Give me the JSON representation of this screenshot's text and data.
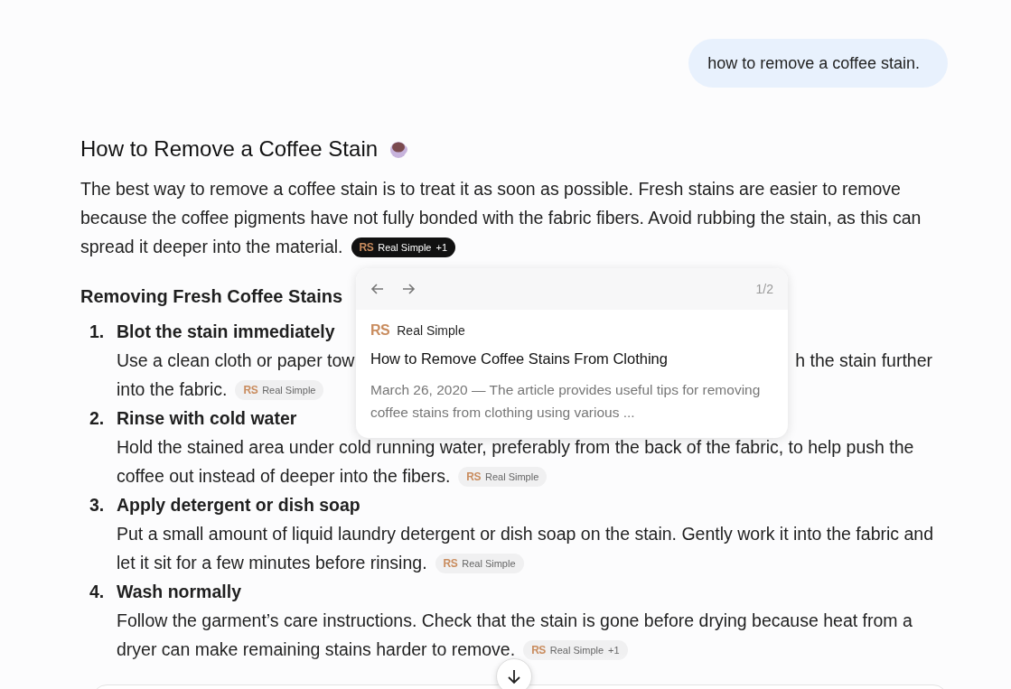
{
  "user_message": "how to remove a coffee stain.",
  "answer": {
    "title": "How to Remove a Coffee Stain",
    "intro": "The best way to remove a coffee stain is to treat it as soon as possible. Fresh stains are easier to remove because the coffee pigments have not fully bonded with the fabric fibers. Avoid rubbing the stain, as this can spread it deeper into the material.",
    "intro_citation": {
      "logo": "RS",
      "source": "Real Simple",
      "extra": "+1",
      "selected": true
    },
    "section_title": "Removing Fresh Coffee Stains",
    "steps": [
      {
        "number": "1.",
        "title": "Blot the stain immediately",
        "body_parts": [
          "Use a clean cloth or paper tow",
          "h the stain further"
        ],
        "body_tail": "into the fabric.",
        "citation": {
          "logo": "RS",
          "source": "Real Simple",
          "selected": false
        }
      },
      {
        "number": "2.",
        "title": "Rinse with cold water",
        "body": "Hold the stained area under cold running water, preferably from the back of the fabric, to help push the coffee out instead of deeper into the fibers.",
        "citation": {
          "logo": "RS",
          "source": "Real Simple",
          "selected": false
        }
      },
      {
        "number": "3.",
        "title": "Apply detergent or dish soap",
        "body": "Put a small amount of liquid laundry detergent or dish soap on the stain. Gently work it into the fabric and let it sit for a few minutes before rinsing.",
        "citation": {
          "logo": "RS",
          "source": "Real Simple",
          "selected": false
        }
      },
      {
        "number": "4.",
        "title": "Wash normally",
        "body": "Follow the garment’s care instructions. Check that the stain is gone before drying because heat from a dryer can make remaining stains harder to remove.",
        "citation": {
          "logo": "RS",
          "source": "Real Simple",
          "extra": "+1",
          "selected": false
        }
      }
    ]
  },
  "popover": {
    "page": "1/2",
    "logo": "RS",
    "source": "Real Simple",
    "title": "How to Remove Coffee Stains From Clothing",
    "snippet": "March 26, 2020 — The article provides useful tips for removing coffee stains from clothing using various ..."
  }
}
